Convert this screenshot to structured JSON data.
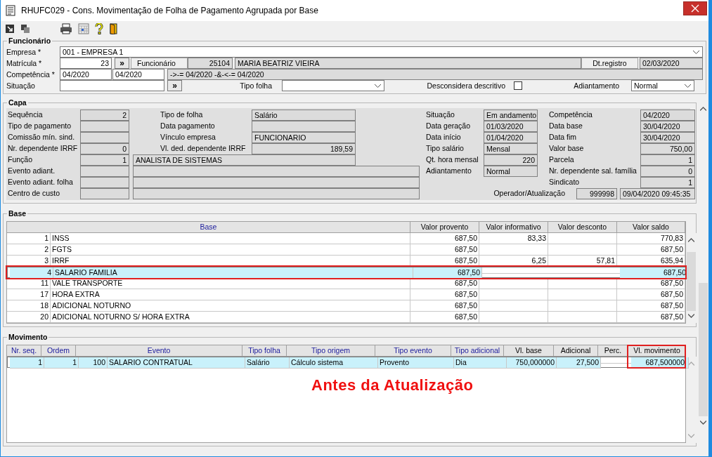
{
  "window": {
    "title": "RHUFC029 - Cons. Movimentação de Folha de Pagamento Agrupada por Base"
  },
  "funcionario": {
    "title": "Funcionário",
    "empresa": {
      "label": "Empresa *",
      "value": "001 - EMPRESA 1"
    },
    "matricula": {
      "label": "Matrícula *",
      "value": "23",
      "button": "»",
      "funcionario_label": "Funcionário",
      "funcionario_codigo": "25104",
      "funcionario_nome": "MARIA BEATRIZ VIEIRA",
      "dt_registro_label": "Dt.registro",
      "dt_registro": "02/03/2020"
    },
    "competencia": {
      "label": "Competência *",
      "from": "04/2020",
      "to": "04/2020",
      "filter": "->-= 04/2020 -&-<-= 04/2020"
    },
    "situacao": {
      "label": "Situação",
      "button": "»"
    },
    "tipo_folha": {
      "label": "Tipo folha"
    },
    "desconsidera": {
      "label": "Desconsidera descritivo",
      "checked": false
    },
    "adiantamento": {
      "label": "Adiantamento",
      "value": "Normal"
    }
  },
  "capa": {
    "title": "Capa",
    "column_1": [
      {
        "label": "Sequência",
        "value": "2",
        "kind": "number"
      },
      {
        "label": "Tipo de pagamento",
        "kind": "number"
      },
      {
        "label": "Comissão mín. sind.",
        "kind": "number"
      },
      {
        "label": "Nr. dependente IRRF",
        "value": "0",
        "kind": "number"
      },
      {
        "label": "Função",
        "value": "1",
        "description": "ANALISTA DE SISTEMAS",
        "kind": "lookup"
      },
      {
        "label": "Evento adiant.",
        "kind": "lookup"
      },
      {
        "label": "Evento adiant. folha",
        "kind": "lookup"
      },
      {
        "label": "Centro de custo",
        "kind": "lookup"
      }
    ],
    "column_2": [
      {
        "label": "Tipo de folha",
        "value": "Salário",
        "kind": "text"
      },
      {
        "label": "Data pagamento",
        "kind": "text"
      },
      {
        "label": "Vínculo empresa",
        "value": "FUNCIONARIO",
        "kind": "text"
      },
      {
        "label": "Vl. ded. dependente IRRF",
        "value": "189,59",
        "kind": "number"
      }
    ],
    "column_3": [
      {
        "label": "Situação",
        "value": "Em andamento",
        "kind": "text"
      },
      {
        "label": "Data geração",
        "value": "01/03/2020",
        "kind": "text"
      },
      {
        "label": "Data início",
        "value": "01/04/2020",
        "kind": "text"
      },
      {
        "label": "Tipo salário",
        "value": "Mensal",
        "kind": "text"
      },
      {
        "label": "Qt. hora mensal",
        "value": "220",
        "kind": "number"
      },
      {
        "label": "Adiantamento",
        "value": "Normal",
        "kind": "text"
      }
    ],
    "column_4": [
      {
        "label": "Competência",
        "value": "04/2020",
        "kind": "text"
      },
      {
        "label": "Data base",
        "value": "30/04/2020",
        "kind": "text"
      },
      {
        "label": "Data fim",
        "value": "30/04/2020",
        "kind": "text"
      },
      {
        "label": "Valor base",
        "value": "750,00",
        "kind": "number"
      },
      {
        "label": "Parcela",
        "value": "1",
        "kind": "number"
      },
      {
        "label": "Nr. dependente sal. família",
        "value": "0",
        "kind": "number"
      },
      {
        "label": "Sindicato",
        "value": "1",
        "kind": "number"
      }
    ],
    "operador": {
      "label": "Operador/Atualização",
      "code": "999998",
      "timestamp": "09/04/2020 09:45:35"
    }
  },
  "base": {
    "title": "Base",
    "columns": [
      {
        "label": "Base",
        "key": true
      },
      {
        "label": "Valor provento",
        "key": false
      },
      {
        "label": "Valor informativo",
        "key": false
      },
      {
        "label": "Valor desconto",
        "key": false
      },
      {
        "label": "Valor saldo",
        "key": false
      }
    ],
    "rows": [
      {
        "number": "1",
        "name": "INSS",
        "provento": "687,50",
        "informativo": "83,33",
        "saldo": "770,83",
        "selected": false,
        "marked": false
      },
      {
        "number": "2",
        "name": "FGTS",
        "provento": "687,50",
        "saldo": "687,50",
        "selected": false,
        "marked": false
      },
      {
        "number": "3",
        "name": "IRRF",
        "provento": "687,50",
        "informativo": "6,25",
        "desconto": "57,81",
        "saldo": "635,94",
        "selected": false,
        "marked": false
      },
      {
        "number": "4",
        "name": "SALARIO FAMILIA",
        "provento": "687,50",
        "saldo": "687,50",
        "selected": true,
        "marked": true
      },
      {
        "number": "11",
        "name": "VALE TRANSPORTE",
        "provento": "687,50",
        "saldo": "687,50",
        "selected": false,
        "marked": false
      },
      {
        "number": "17",
        "name": "HORA EXTRA",
        "provento": "687,50",
        "saldo": "687,50",
        "selected": false,
        "marked": false
      },
      {
        "number": "18",
        "name": "ADICIONAL NOTURNO",
        "provento": "687,50",
        "saldo": "687,50",
        "selected": false,
        "marked": false
      },
      {
        "number": "20",
        "name": "ADICIONAL NOTURNO S/ HORA EXTRA",
        "provento": "687,50",
        "saldo": "687,50",
        "selected": false,
        "marked": false
      }
    ]
  },
  "movimento": {
    "title": "Movimento",
    "columns": [
      {
        "label": "Nr. seq.",
        "key": true,
        "marked": false
      },
      {
        "label": "Ordem",
        "key": true,
        "marked": false
      },
      {
        "label": "Evento",
        "key": true,
        "marked": false
      },
      {
        "label": "Tipo folha",
        "key": true,
        "marked": false
      },
      {
        "label": "Tipo origem",
        "key": true,
        "marked": false
      },
      {
        "label": "Tipo evento",
        "key": true,
        "marked": false
      },
      {
        "label": "Tipo adicional",
        "key": true,
        "marked": false
      },
      {
        "label": "Vl. base",
        "key": false,
        "marked": false
      },
      {
        "label": "Adicional",
        "key": false,
        "marked": false
      },
      {
        "label": "Perc.",
        "key": false,
        "marked": false
      },
      {
        "label": "Vl. movimento",
        "key": false,
        "marked": true
      }
    ],
    "rows": [
      {
        "nr_seq": "1",
        "ordem": "1",
        "evento_codigo": "100",
        "evento": "SALARIO CONTRATUAL",
        "tipo_folha": "Salário",
        "tipo_origem": "Cálculo sistema",
        "tipo_evento": "Provento",
        "tipo_adicional": "Dia",
        "vl_base": "750,000000",
        "adicional": "27,500",
        "vl_movimento": "687,500000",
        "selected": true
      }
    ],
    "annotation": "Antes da Atualização"
  }
}
